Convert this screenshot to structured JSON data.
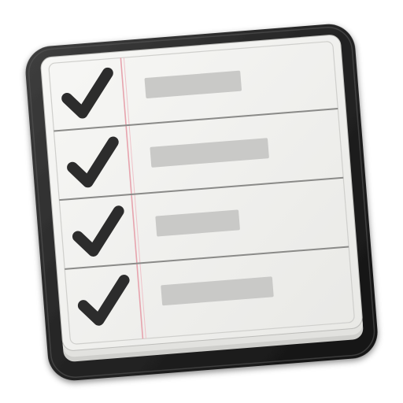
{
  "icon": {
    "name": "reminders-app-icon",
    "depicts": "checklist-icon",
    "colors": {
      "case_dark": "#1c1c1c",
      "case_light": "#3e3e3e",
      "paper": "#f1f1ef",
      "paper_edge": "#d9d9d6",
      "rule_line": "#8a8a88",
      "margin_line": "#e7a3ad",
      "check": "#2c2c2c",
      "task_bar": "#c9c9c7"
    },
    "items": [
      {
        "checked": true,
        "icon": "checkmark-icon",
        "placeholder": "task-bar"
      },
      {
        "checked": true,
        "icon": "checkmark-icon",
        "placeholder": "task-bar"
      },
      {
        "checked": true,
        "icon": "checkmark-icon",
        "placeholder": "task-bar"
      },
      {
        "checked": true,
        "icon": "checkmark-icon",
        "placeholder": "task-bar"
      }
    ]
  }
}
